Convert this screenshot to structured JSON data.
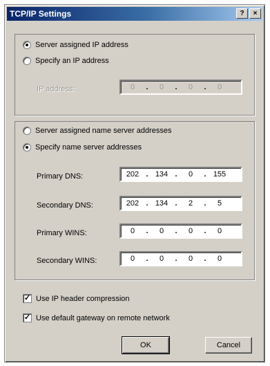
{
  "window": {
    "title": "TCP/IP Settings",
    "help_glyph": "?",
    "close_glyph": "×"
  },
  "ip_group": {
    "server_assigned_label": "Server assigned IP address",
    "specify_label": "Specify an IP address",
    "ip_address_label": "IP address:",
    "ip_octets": [
      "0",
      "0",
      "0",
      "0"
    ]
  },
  "dns_group": {
    "server_assigned_label": "Server assigned name server addresses",
    "specify_label": "Specify name server addresses",
    "primary_dns_label": "Primary DNS:",
    "primary_dns": [
      "202",
      "134",
      "0",
      "155"
    ],
    "secondary_dns_label": "Secondary DNS:",
    "secondary_dns": [
      "202",
      "134",
      "2",
      "5"
    ],
    "primary_wins_label": "Primary WINS:",
    "primary_wins": [
      "0",
      "0",
      "0",
      "0"
    ],
    "secondary_wins_label": "Secondary WINS:",
    "secondary_wins": [
      "0",
      "0",
      "0",
      "0"
    ]
  },
  "options": {
    "ip_header_compression_label": "Use IP header compression",
    "default_gateway_label": "Use default gateway on remote network",
    "check_mark": "✓"
  },
  "buttons": {
    "ok": "OK",
    "cancel": "Cancel"
  }
}
